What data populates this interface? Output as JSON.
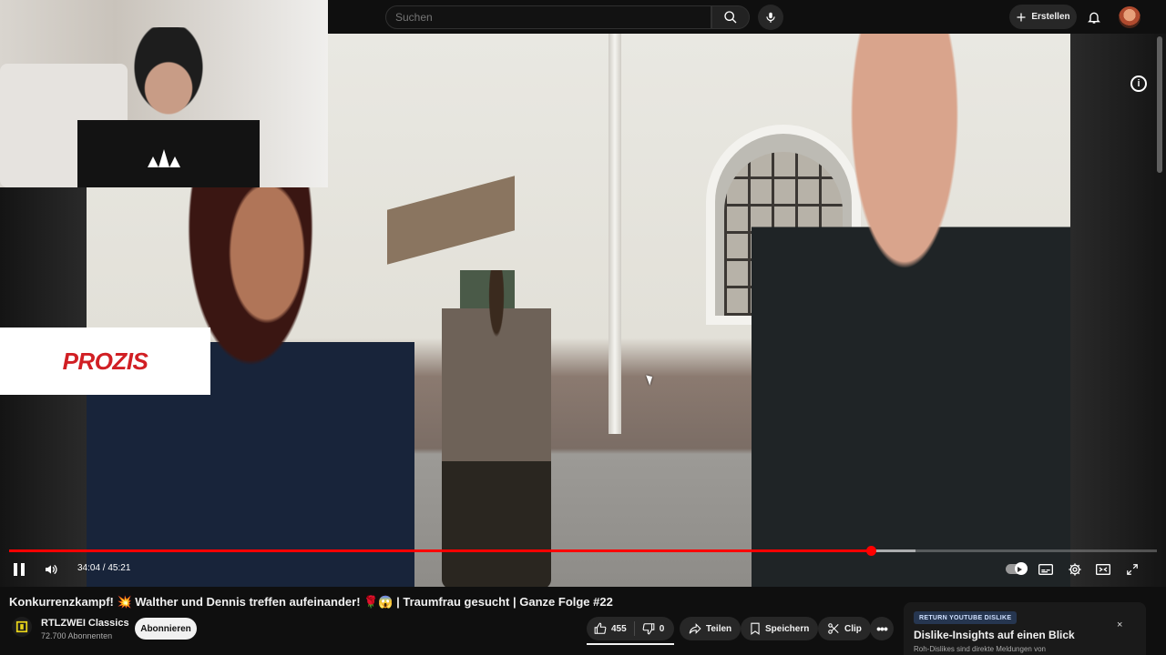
{
  "header": {
    "search": {
      "placeholder": "Suchen",
      "value": ""
    },
    "create_label": "Erstellen"
  },
  "player": {
    "ad_brand": "PROZIS",
    "time_current": "34:04",
    "time_total": "45:21",
    "time_display": "34:04 / 45:21",
    "progress_played_fraction": 0.7505,
    "progress_buffered_fraction": 0.79,
    "accent_color": "#ff0000"
  },
  "video": {
    "title": "Konkurrenzkampf! 💥 Walther und Dennis treffen aufeinander! 🌹😱 | Traumfrau gesucht | Ganze Folge #22"
  },
  "channel": {
    "name": "RTLZWEI Classics",
    "subscribers": "72.700 Abonnenten",
    "subscribe_label": "Abonnieren"
  },
  "actions": {
    "likes": "455",
    "dislikes": "0",
    "share_label": "Teilen",
    "save_label": "Speichern",
    "clip_label": "Clip",
    "more_label": "•••"
  },
  "ryd_panel": {
    "badge": "RETURN YOUTUBE DISLIKE",
    "title": "Dislike-Insights auf einen Blick",
    "subtitle": "Roh-Dislikes sind direkte Meldungen von",
    "close_label": "×"
  },
  "icons": {
    "search": "search-icon",
    "mic": "microphone-icon",
    "create": "plus-icon",
    "notifications": "bell-icon",
    "info": "info-icon",
    "play_pause": "pause-icon",
    "volume": "volume-icon",
    "autoplay": "autoplay-toggle",
    "captions": "captions-icon",
    "settings": "gear-icon",
    "theater": "theater-mode-icon",
    "fullscreen": "fullscreen-icon",
    "like": "thumbs-up-icon",
    "dislike": "thumbs-down-icon",
    "share": "share-icon",
    "save": "bookmark-icon",
    "clip": "scissors-icon"
  },
  "info_glyph": "i"
}
